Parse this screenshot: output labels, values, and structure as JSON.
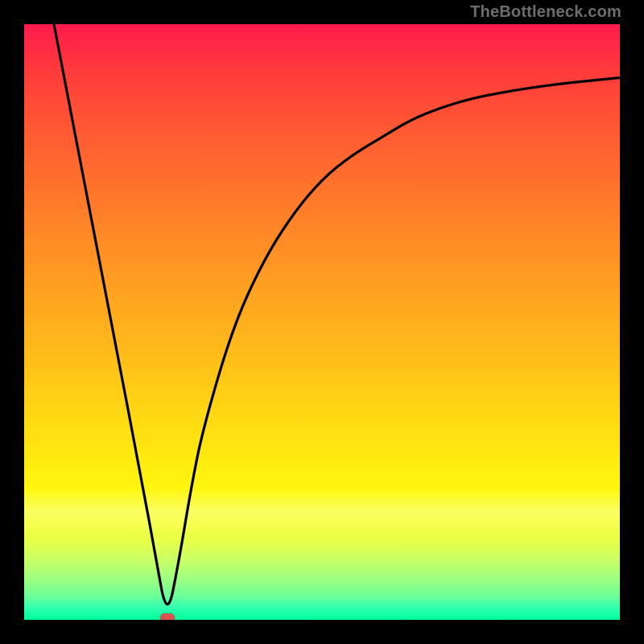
{
  "watermark": "TheBottleneck.com",
  "colors": {
    "frame": "#000000",
    "marker": "#d9534f",
    "curve": "#000000",
    "gradient_top": "#ff1a4d",
    "gradient_bottom": "#00ff9c"
  },
  "chart_data": {
    "type": "line",
    "title": "",
    "xlabel": "",
    "ylabel": "",
    "xlim": [
      0,
      100
    ],
    "ylim": [
      0,
      100
    ],
    "grid": false,
    "legend": false,
    "annotations": [
      {
        "kind": "marker",
        "x": 24,
        "y": 0,
        "shape": "pill",
        "color": "#d9534f"
      }
    ],
    "series": [
      {
        "name": "curve",
        "color": "#000000",
        "x": [
          5,
          10,
          15,
          20,
          22,
          24,
          26,
          28,
          30,
          35,
          40,
          45,
          50,
          55,
          60,
          65,
          70,
          75,
          80,
          85,
          90,
          95,
          100
        ],
        "y": [
          100,
          74,
          48,
          22,
          11,
          0,
          10,
          22,
          32,
          49,
          60,
          68,
          74,
          78,
          81,
          84,
          86,
          87.5,
          88.5,
          89.3,
          90,
          90.5,
          91
        ]
      }
    ],
    "background_gradient": {
      "direction": "top-to-bottom",
      "meaning": "red (high) to green (low) — lower is better",
      "stops": [
        {
          "pos": 0.0,
          "color": "#ff1a4d"
        },
        {
          "pos": 0.5,
          "color": "#ffb81a"
        },
        {
          "pos": 0.8,
          "color": "#fff60f"
        },
        {
          "pos": 1.0,
          "color": "#00ff9c"
        }
      ]
    }
  }
}
